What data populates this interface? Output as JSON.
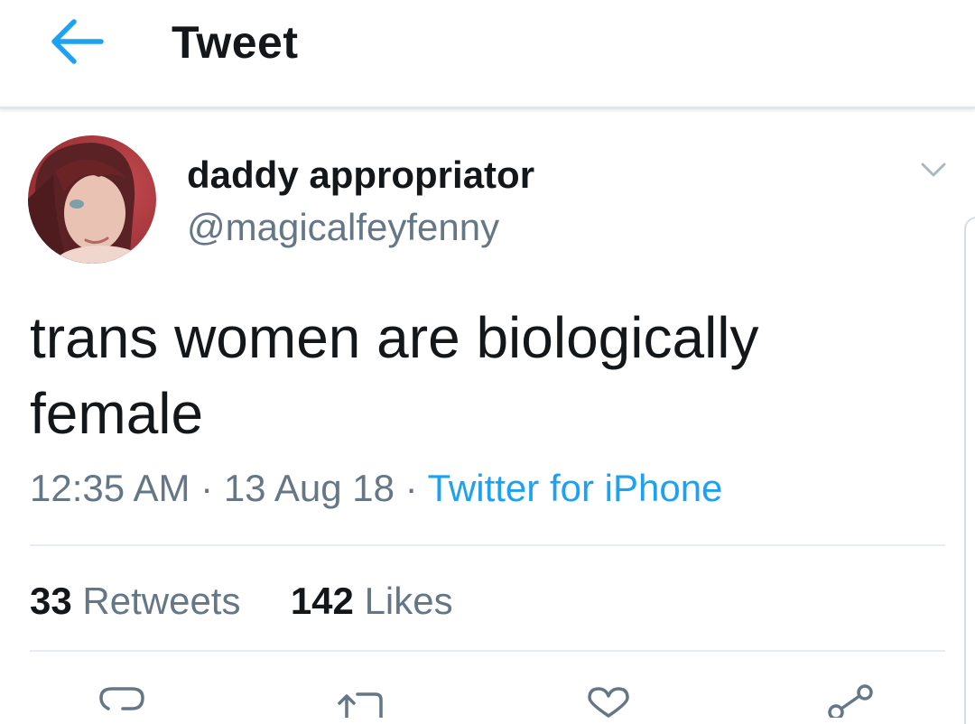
{
  "header": {
    "back_icon": "arrow-left-icon",
    "title": "Tweet",
    "accent_color": "#1da1f2"
  },
  "tweet": {
    "author": {
      "display_name": "daddy appropriator",
      "handle": "@magicalfeyfenny",
      "avatar_icon": "profile-photo"
    },
    "menu_icon": "chevron-down-icon",
    "text": "trans women are biologically female",
    "time": "12:35 AM",
    "separator": "·",
    "date": "13 Aug 18",
    "source": "Twitter for iPhone",
    "stats": {
      "retweets_count": "33",
      "retweets_label": "Retweets",
      "likes_count": "142",
      "likes_label": "Likes"
    },
    "actions": [
      {
        "icon": "reply-icon"
      },
      {
        "icon": "retweet-icon"
      },
      {
        "icon": "like-icon"
      },
      {
        "icon": "share-icon"
      }
    ]
  }
}
